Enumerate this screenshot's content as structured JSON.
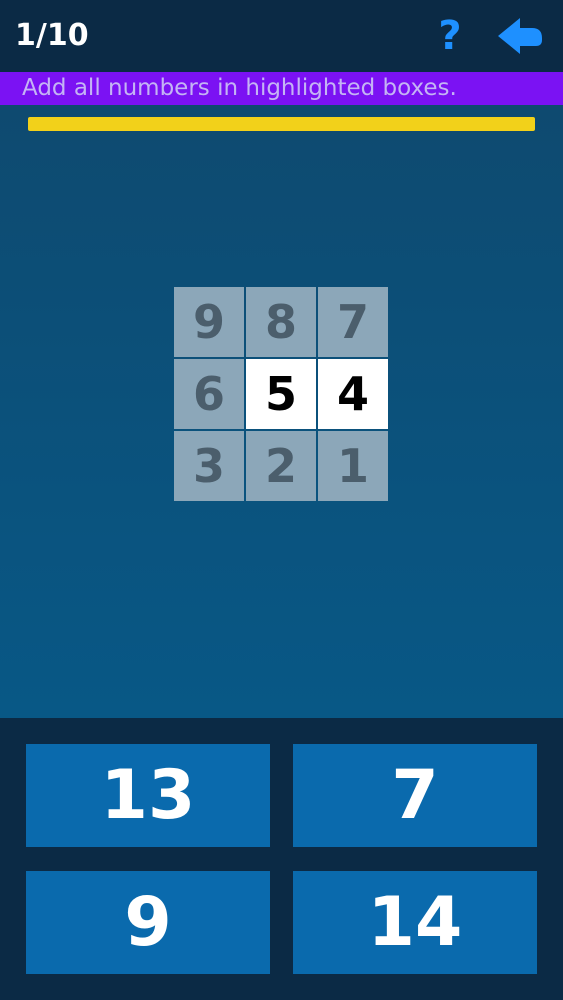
{
  "header": {
    "progress": "1/10",
    "help_label": "?",
    "back_icon": "arrow-left-icon",
    "accent_color": "#1e90ff"
  },
  "instruction": {
    "text": "Add all numbers in highlighted boxes.",
    "color": "#7b12f3"
  },
  "timer": {
    "remaining_fraction": 1.0,
    "color": "#f2d11a"
  },
  "grid": {
    "rows": [
      [
        {
          "value": "9",
          "highlighted": false
        },
        {
          "value": "8",
          "highlighted": false
        },
        {
          "value": "7",
          "highlighted": false
        }
      ],
      [
        {
          "value": "6",
          "highlighted": false
        },
        {
          "value": "5",
          "highlighted": true
        },
        {
          "value": "4",
          "highlighted": true
        }
      ],
      [
        {
          "value": "3",
          "highlighted": false
        },
        {
          "value": "2",
          "highlighted": false
        },
        {
          "value": "1",
          "highlighted": false
        }
      ]
    ]
  },
  "answers": [
    {
      "label": "13"
    },
    {
      "label": "7"
    },
    {
      "label": "9"
    },
    {
      "label": "14"
    }
  ]
}
